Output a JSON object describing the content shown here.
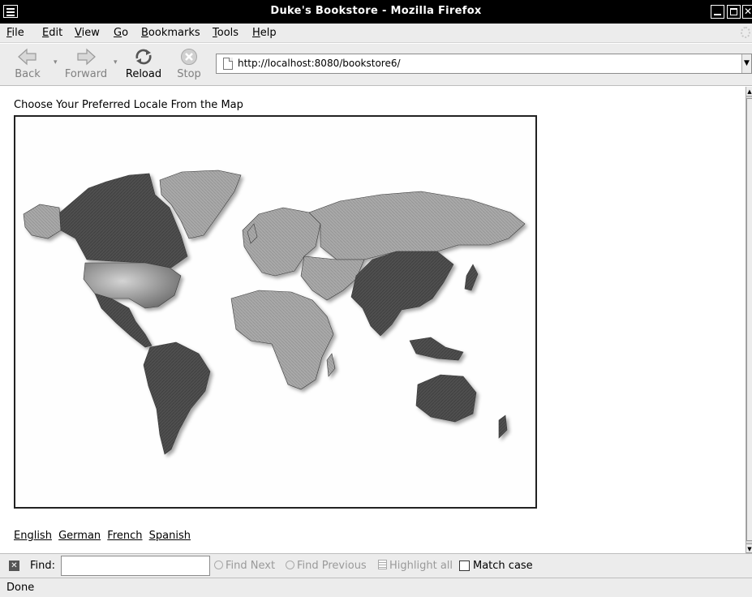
{
  "window": {
    "title": "Duke's Bookstore - Mozilla Firefox"
  },
  "menubar": {
    "items": [
      "File",
      "Edit",
      "View",
      "Go",
      "Bookmarks",
      "Tools",
      "Help"
    ]
  },
  "toolbar": {
    "back_label": "Back",
    "forward_label": "Forward",
    "reload_label": "Reload",
    "stop_label": "Stop",
    "url": "http://localhost:8080/bookstore6/"
  },
  "content": {
    "heading": "Choose Your Preferred Locale From the Map",
    "locale_links": [
      "English",
      "German",
      "French",
      "Spanish"
    ]
  },
  "findbar": {
    "label": "Find:",
    "input_value": "",
    "find_next": "Find Next",
    "find_previous": "Find Previous",
    "highlight_all": "Highlight all",
    "match_case": "Match case",
    "match_case_checked": false
  },
  "statusbar": {
    "text": "Done"
  },
  "colors": {
    "chrome_bg": "#ececec",
    "title_bg": "#000000",
    "map_dark": "#4f4f4f",
    "map_light": "#a8a8a8"
  }
}
